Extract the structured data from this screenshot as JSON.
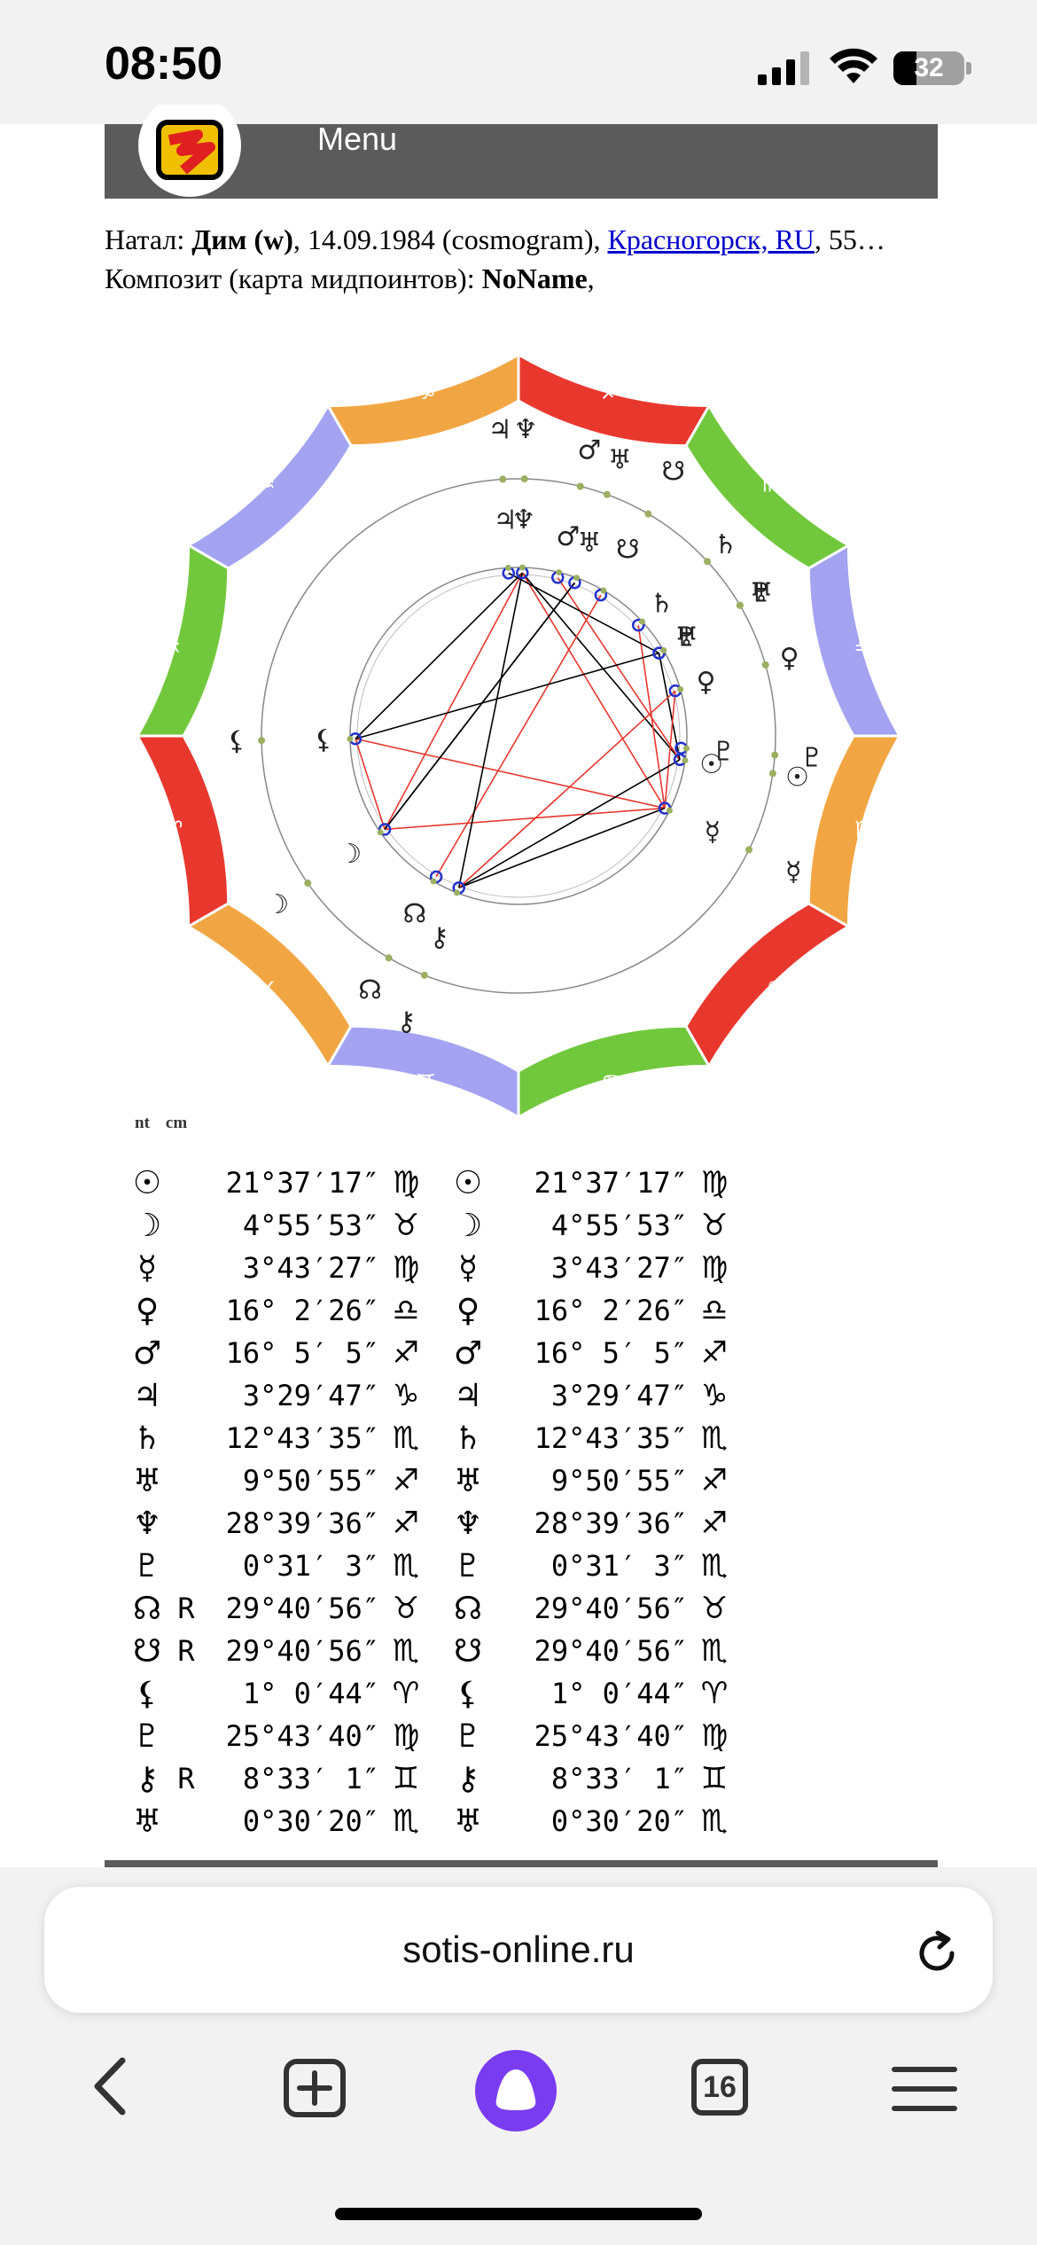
{
  "status_bar": {
    "time": "08:50",
    "battery": "32"
  },
  "site_header": {
    "menu_label": "Menu"
  },
  "chart_info": {
    "natal_prefix": "Натал: ",
    "person_name": "Дим (w)",
    "date_text": ", 14.09.1984 (cosmogram), ",
    "location_link": "Красногорск, RU",
    "coords_text": ", 55…",
    "composite_prefix": "Композит (карта мидпоинтов): ",
    "composite_name": "NoName",
    "composite_suffix": ","
  },
  "chart_legend": {
    "natal_label": "nt",
    "composite_label": "cm"
  },
  "zodiac_ring": [
    {
      "sign": "♈",
      "color": "#e8382e"
    },
    {
      "sign": "♉",
      "color": "#f2a643"
    },
    {
      "sign": "♊",
      "color": "#a3a3f2"
    },
    {
      "sign": "♋",
      "color": "#72c83c"
    },
    {
      "sign": "♌",
      "color": "#e8382e"
    },
    {
      "sign": "♍",
      "color": "#f2a643"
    },
    {
      "sign": "♎",
      "color": "#a3a3f2"
    },
    {
      "sign": "♏",
      "color": "#72c83c"
    },
    {
      "sign": "♐",
      "color": "#e8382e"
    },
    {
      "sign": "♑",
      "color": "#f2a643"
    },
    {
      "sign": "♒",
      "color": "#a3a3f2"
    },
    {
      "sign": "♓",
      "color": "#72c83c"
    }
  ],
  "planet_positions": [
    {
      "glyph": "☉",
      "retro": "",
      "natal": "21°37′17″",
      "natal_sign": "♍",
      "comp": "21°37′17″",
      "comp_sign": "♍"
    },
    {
      "glyph": "☽",
      "retro": "",
      "natal": "4°55′53″",
      "natal_sign": "♉",
      "comp": "4°55′53″",
      "comp_sign": "♉"
    },
    {
      "glyph": "☿",
      "retro": "",
      "natal": "3°43′27″",
      "natal_sign": "♍",
      "comp": "3°43′27″",
      "comp_sign": "♍"
    },
    {
      "glyph": "♀",
      "retro": "",
      "natal": "16° 2′26″",
      "natal_sign": "♎",
      "comp": "16° 2′26″",
      "comp_sign": "♎"
    },
    {
      "glyph": "♂",
      "retro": "",
      "natal": "16° 5′ 5″",
      "natal_sign": "♐",
      "comp": "16° 5′ 5″",
      "comp_sign": "♐"
    },
    {
      "glyph": "♃",
      "retro": "",
      "natal": "3°29′47″",
      "natal_sign": "♑",
      "comp": "3°29′47″",
      "comp_sign": "♑"
    },
    {
      "glyph": "♄",
      "retro": "",
      "natal": "12°43′35″",
      "natal_sign": "♏",
      "comp": "12°43′35″",
      "comp_sign": "♏"
    },
    {
      "glyph": "♅",
      "retro": "",
      "natal": "9°50′55″",
      "natal_sign": "♐",
      "comp": "9°50′55″",
      "comp_sign": "♐"
    },
    {
      "glyph": "♆",
      "retro": "",
      "natal": "28°39′36″",
      "natal_sign": "♐",
      "comp": "28°39′36″",
      "comp_sign": "♐"
    },
    {
      "glyph": "♇",
      "retro": "",
      "natal": "0°31′ 3″",
      "natal_sign": "♏",
      "comp": "0°31′ 3″",
      "comp_sign": "♏"
    },
    {
      "glyph": "☊",
      "retro": "R",
      "natal": "29°40′56″",
      "natal_sign": "♉",
      "comp": "29°40′56″",
      "comp_sign": "♉"
    },
    {
      "glyph": "☋",
      "retro": "R",
      "natal": "29°40′56″",
      "natal_sign": "♏",
      "comp": "29°40′56″",
      "comp_sign": "♏"
    },
    {
      "glyph": "⚸",
      "retro": "",
      "natal": "1° 0′44″",
      "natal_sign": "♈",
      "comp": "1° 0′44″",
      "comp_sign": "♈"
    },
    {
      "glyph": "♇",
      "retro": "",
      "natal": "25°43′40″",
      "natal_sign": "♍",
      "comp": "25°43′40″",
      "comp_sign": "♍"
    },
    {
      "glyph": "⚷",
      "retro": "R",
      "natal": "8°33′ 1″",
      "natal_sign": "♊",
      "comp": "8°33′ 1″",
      "comp_sign": "♊"
    },
    {
      "glyph": "♅",
      "retro": "",
      "natal": "0°30′20″",
      "natal_sign": "♏",
      "comp": "0°30′20″",
      "comp_sign": "♏"
    }
  ],
  "browser": {
    "url": "sotis-online.ru",
    "tab_count": "16"
  },
  "colors": {
    "header_bg": "#5b5b5b",
    "aspect_red": "#e8382e",
    "aspect_black": "#000000",
    "planet_marker": "#2233cc",
    "link_blue": "#0000cc",
    "alice_purple": "#7a3cf0"
  }
}
